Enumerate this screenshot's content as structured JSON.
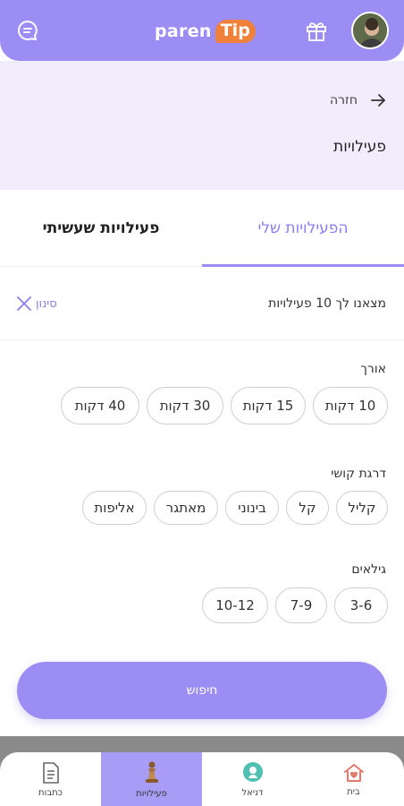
{
  "header": {
    "logo_left": "paren",
    "logo_right": "Tip"
  },
  "subheader": {
    "back_label": "חזרה",
    "title": "פעילויות"
  },
  "tabs": [
    {
      "label": "הפעילויות שלי",
      "active": true
    },
    {
      "label": "פעילויות שעשיתי",
      "active": false
    }
  ],
  "results": {
    "count_text": "מצאנו לך 10 פעילויות",
    "filter_label": "סינון"
  },
  "length": {
    "label": "אורך",
    "options": [
      "10 דקות",
      "15 דקות",
      "30 דקות",
      "40 דקות"
    ]
  },
  "difficulty": {
    "label": "דרגת קושי",
    "options": [
      "קליל",
      "קל",
      "בינוני",
      "מאתגר",
      "אליפות"
    ]
  },
  "ages": {
    "label": "גילאים",
    "options": [
      "3-6",
      "7-9",
      "10-12"
    ]
  },
  "search_button": "חיפוש",
  "bottom_nav": [
    {
      "label": "בית",
      "icon": "home-icon"
    },
    {
      "label": "דניאל",
      "icon": "child-balloon-icon"
    },
    {
      "label": "פעילויות",
      "icon": "chess-piece-icon",
      "active": true
    },
    {
      "label": "כתבות",
      "icon": "article-icon"
    }
  ],
  "colors": {
    "primary": "#9c8df5",
    "accent": "#f0813a",
    "subheader_bg": "#f1edfd"
  }
}
